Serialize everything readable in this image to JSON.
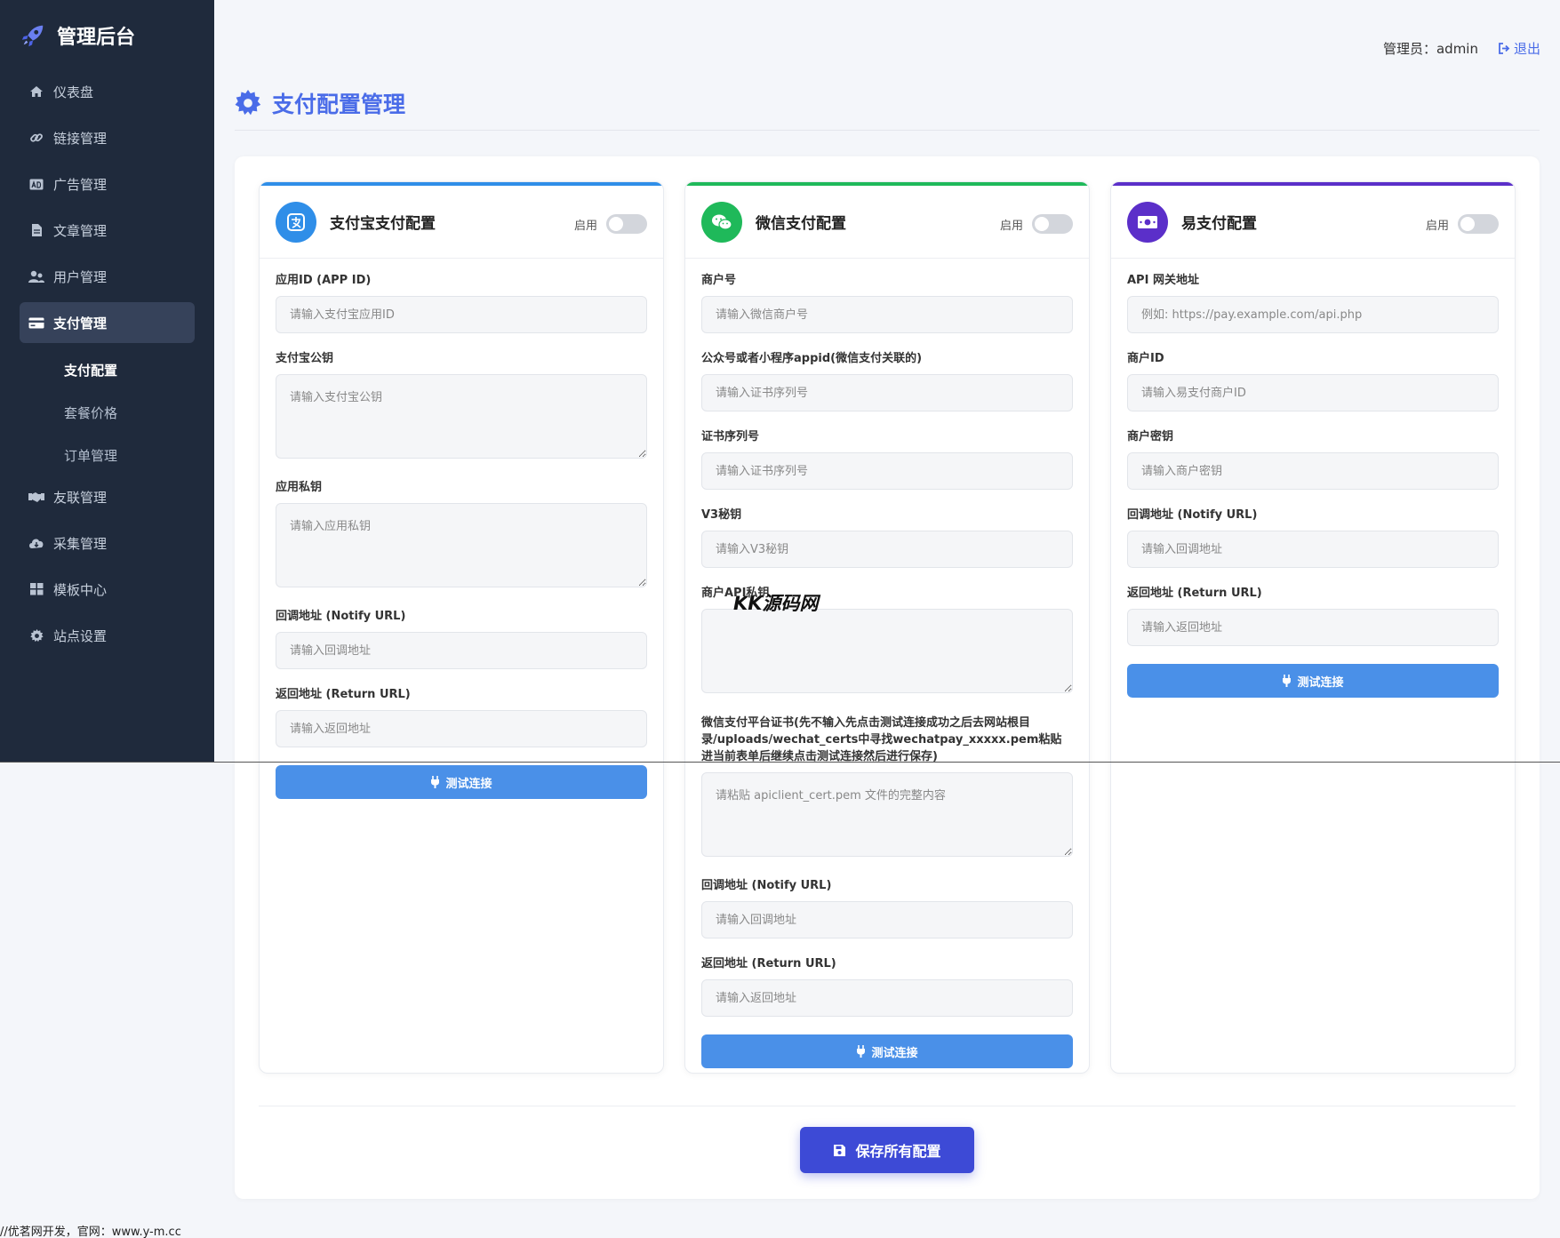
{
  "sidebar": {
    "brand": "管理后台",
    "items": [
      {
        "label": "仪表盘",
        "icon": "home-icon"
      },
      {
        "label": "链接管理",
        "icon": "link-icon"
      },
      {
        "label": "广告管理",
        "icon": "ad-icon"
      },
      {
        "label": "文章管理",
        "icon": "file-icon"
      },
      {
        "label": "用户管理",
        "icon": "users-icon"
      },
      {
        "label": "支付管理",
        "icon": "credit-card-icon",
        "active": true
      },
      {
        "label": "友联管理",
        "icon": "handshake-icon"
      },
      {
        "label": "采集管理",
        "icon": "cloud-download-icon"
      },
      {
        "label": "模板中心",
        "icon": "grid-icon"
      },
      {
        "label": "站点设置",
        "icon": "gear-icon"
      }
    ],
    "sub_items": [
      {
        "label": "支付配置",
        "active": true
      },
      {
        "label": "套餐价格"
      },
      {
        "label": "订单管理"
      }
    ]
  },
  "header": {
    "admin_label": "管理员：admin",
    "logout": "退出"
  },
  "page": {
    "title": "支付配置管理"
  },
  "enable_label": "启用",
  "test_button": "测试连接",
  "alipay": {
    "title": "支付宝支付配置",
    "color": "#2f8ee8",
    "app_id_label": "应用ID (APP ID)",
    "app_id_placeholder": "请输入支付宝应用ID",
    "public_key_label": "支付宝公钥",
    "public_key_placeholder": "请输入支付宝公钥",
    "private_key_label": "应用私钥",
    "private_key_placeholder": "请输入应用私钥",
    "notify_label": "回调地址 (Notify URL)",
    "notify_placeholder": "请输入回调地址",
    "return_label": "返回地址 (Return URL)",
    "return_placeholder": "请输入返回地址"
  },
  "wechat": {
    "title": "微信支付配置",
    "color": "#1fb95a",
    "mch_id_label": "商户号",
    "mch_id_placeholder": "请输入微信商户号",
    "appid_label": "公众号或者小程序appid(微信支付关联的)",
    "appid_placeholder": "请输入证书序列号",
    "serial_label": "证书序列号",
    "serial_placeholder": "请输入证书序列号",
    "v3_label": "V3秘钥",
    "v3_placeholder": "请输入V3秘钥",
    "api_key_label": "商户API私钥",
    "cert_label": "微信支付平台证书(先不输入先点击测试连接成功之后去网站根目录/uploads/wechat_certs中寻找wechatpay_xxxxx.pem粘贴进当前表单后继续点击测试连接然后进行保存)",
    "cert_placeholder": "请粘贴 apiclient_cert.pem 文件的完整内容",
    "notify_label": "回调地址 (Notify URL)",
    "notify_placeholder": "请输入回调地址",
    "return_label": "返回地址 (Return URL)",
    "return_placeholder": "请输入返回地址"
  },
  "epay": {
    "title": "易支付配置",
    "color": "#5b2fc9",
    "gateway_label": "API 网关地址",
    "gateway_placeholder": "例如: https://pay.example.com/api.php",
    "mch_id_label": "商户ID",
    "mch_id_placeholder": "请输入易支付商户ID",
    "key_label": "商户密钥",
    "key_placeholder": "请输入商户密钥",
    "notify_label": "回调地址 (Notify URL)",
    "notify_placeholder": "请输入回调地址",
    "return_label": "返回地址 (Return URL)",
    "return_placeholder": "请输入返回地址"
  },
  "save_button": "保存所有配置",
  "watermark": "KK源码网",
  "footer": "//优茗网开发，官网：www.y-m.cc"
}
